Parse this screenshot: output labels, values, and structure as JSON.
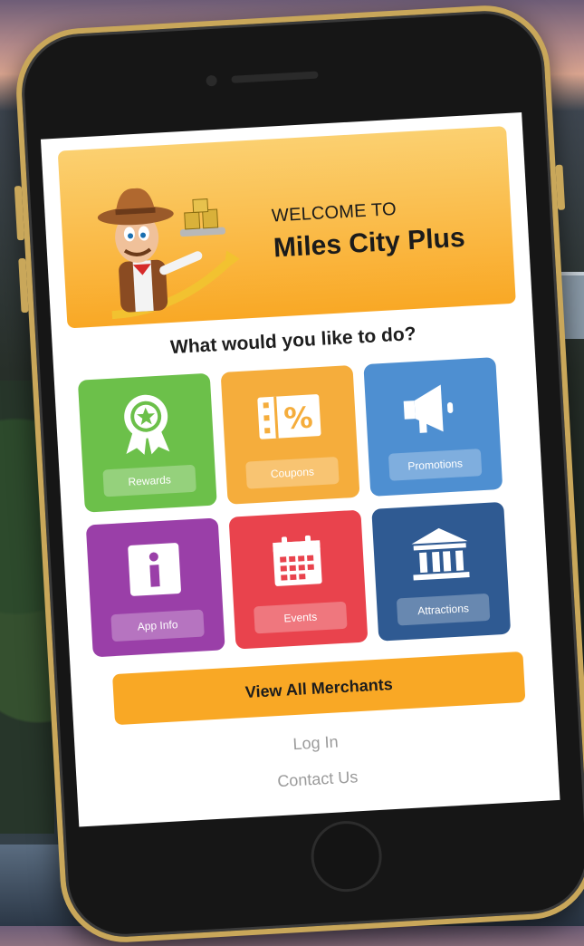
{
  "banner": {
    "welcome_line": "WELCOME TO",
    "app_name": "Miles City Plus"
  },
  "prompt": "What would you like to do?",
  "tiles": [
    {
      "label": "Rewards",
      "icon": "rewards-ribbon-icon",
      "color": "#6cc04a"
    },
    {
      "label": "Coupons",
      "icon": "coupon-percent-icon",
      "color": "#f5ad3c"
    },
    {
      "label": "Promotions",
      "icon": "megaphone-icon",
      "color": "#4e8fd1"
    },
    {
      "label": "App Info",
      "icon": "info-icon",
      "color": "#9a3fa8"
    },
    {
      "label": "Events",
      "icon": "calendar-icon",
      "color": "#e9434d"
    },
    {
      "label": "Attractions",
      "icon": "landmark-icon",
      "color": "#2f5a92"
    }
  ],
  "actions": {
    "view_all_merchants": "View All Merchants",
    "log_in": "Log In",
    "contact_us": "Contact Us"
  },
  "colors": {
    "accent": "#f9a825",
    "phone_frame": "#c9a75a"
  }
}
